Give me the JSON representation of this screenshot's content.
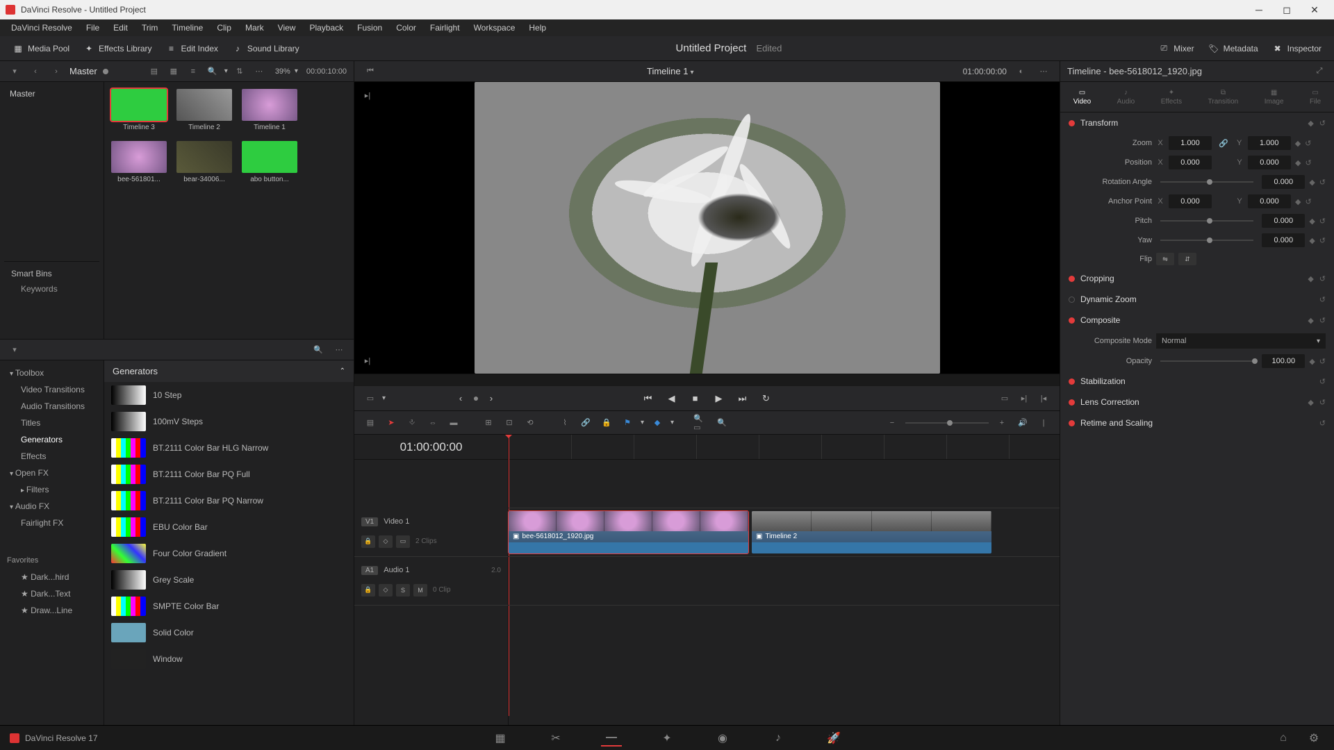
{
  "window": {
    "title": "DaVinci Resolve - Untitled Project"
  },
  "menu": [
    "DaVinci Resolve",
    "File",
    "Edit",
    "Trim",
    "Timeline",
    "Clip",
    "Mark",
    "View",
    "Playback",
    "Fusion",
    "Color",
    "Fairlight",
    "Workspace",
    "Help"
  ],
  "toolbar": {
    "media_pool": "Media Pool",
    "effects_library": "Effects Library",
    "edit_index": "Edit Index",
    "sound_library": "Sound Library",
    "project_title": "Untitled Project",
    "project_status": "Edited",
    "mixer": "Mixer",
    "metadata": "Metadata",
    "inspector": "Inspector"
  },
  "pool": {
    "bin": "Master",
    "zoom_pct": "39%",
    "timecode": "00:00:10:00",
    "tree": {
      "root": "Master"
    },
    "smartbins_header": "Smart Bins",
    "smartbins_items": [
      "Keywords"
    ],
    "items": [
      {
        "label": "Timeline 3",
        "kind": "green"
      },
      {
        "label": "Timeline 2",
        "kind": "bw"
      },
      {
        "label": "Timeline 1",
        "kind": "flower"
      },
      {
        "label": "bee-561801...",
        "kind": "flower"
      },
      {
        "label": "bear-34006...",
        "kind": "bear"
      },
      {
        "label": "abo button...",
        "kind": "green"
      }
    ]
  },
  "fx": {
    "favorites_header": "Favorites",
    "tree": [
      {
        "label": "Toolbox",
        "indent": 0
      },
      {
        "label": "Video Transitions",
        "indent": 1
      },
      {
        "label": "Audio Transitions",
        "indent": 1
      },
      {
        "label": "Titles",
        "indent": 1
      },
      {
        "label": "Generators",
        "indent": 1,
        "sel": true
      },
      {
        "label": "Effects",
        "indent": 1
      },
      {
        "label": "Open FX",
        "indent": 0
      },
      {
        "label": "Filters",
        "indent": 1
      },
      {
        "label": "Audio FX",
        "indent": 0
      },
      {
        "label": "Fairlight FX",
        "indent": 1
      }
    ],
    "favorites": [
      "Dark...hird",
      "Dark...Text",
      "Draw...Line"
    ],
    "list_header": "Generators",
    "items": [
      {
        "name": "10 Step",
        "sw": "grey"
      },
      {
        "name": "100mV Steps",
        "sw": "grey"
      },
      {
        "name": "BT.2111 Color Bar HLG Narrow",
        "sw": "bars"
      },
      {
        "name": "BT.2111 Color Bar PQ Full",
        "sw": "bars"
      },
      {
        "name": "BT.2111 Color Bar PQ Narrow",
        "sw": "bars"
      },
      {
        "name": "EBU Color Bar",
        "sw": "bars"
      },
      {
        "name": "Four Color Gradient",
        "sw": "grad"
      },
      {
        "name": "Grey Scale",
        "sw": "grey"
      },
      {
        "name": "SMPTE Color Bar",
        "sw": "bars"
      },
      {
        "name": "Solid Color",
        "sw": "solid"
      },
      {
        "name": "Window",
        "sw": "grey"
      }
    ]
  },
  "viewer": {
    "title": "Timeline 1",
    "tc_right": "01:00:00:00"
  },
  "timeline": {
    "tc": "01:00:00:00",
    "video_track_badge": "V1",
    "video_track_name": "Video 1",
    "video_clip_count": "2 Clips",
    "audio_track_badge": "A1",
    "audio_track_name": "Audio 1",
    "audio_meter": "2.0",
    "audio_clip_count": "0 Clip",
    "clip1_label": "bee-5618012_1920.jpg",
    "clip2_label": "Timeline 2"
  },
  "inspector": {
    "title": "Timeline - bee-5618012_1920.jpg",
    "tabs": [
      "Video",
      "Audio",
      "Effects",
      "Transition",
      "Image",
      "File"
    ],
    "transform": {
      "header": "Transform",
      "zoom_label": "Zoom",
      "zoom_x": "1.000",
      "zoom_y": "1.000",
      "position_label": "Position",
      "pos_x": "0.000",
      "pos_y": "0.000",
      "rotation_label": "Rotation Angle",
      "rotation": "0.000",
      "anchor_label": "Anchor Point",
      "anchor_x": "0.000",
      "anchor_y": "0.000",
      "pitch_label": "Pitch",
      "pitch": "0.000",
      "yaw_label": "Yaw",
      "yaw": "0.000",
      "flip_label": "Flip"
    },
    "sections": {
      "cropping": "Cropping",
      "dynamic_zoom": "Dynamic Zoom",
      "composite": "Composite",
      "composite_mode_label": "Composite Mode",
      "composite_mode": "Normal",
      "opacity_label": "Opacity",
      "opacity": "100.00",
      "stabilization": "Stabilization",
      "lens_correction": "Lens Correction",
      "retime": "Retime and Scaling"
    }
  },
  "footer": {
    "version": "DaVinci Resolve 17"
  }
}
